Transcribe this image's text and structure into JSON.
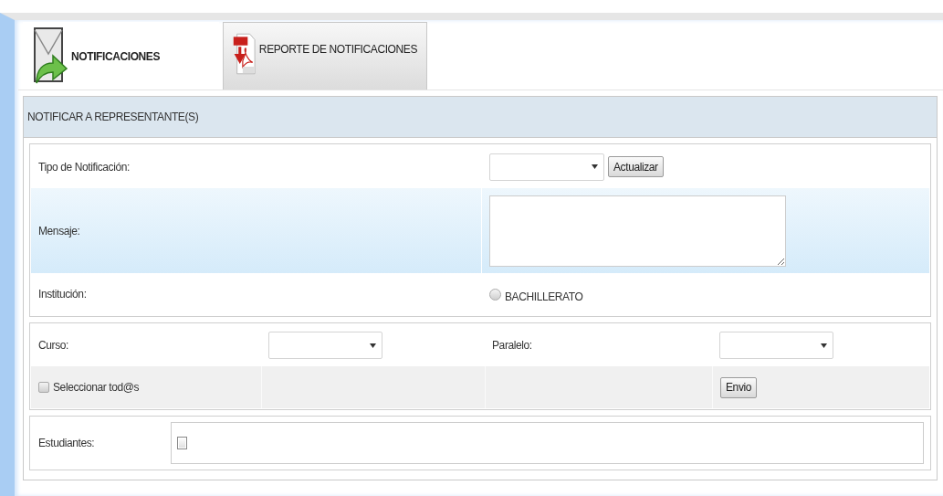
{
  "tabs": [
    {
      "label": "NOTIFICACIONES",
      "selected": true,
      "kind": "mail"
    },
    {
      "label": "REPORTE DE NOTIFICACIONES",
      "selected": false,
      "kind": "pdf"
    }
  ],
  "panel": {
    "title": "NOTIFICAR A REPRESENTANTE(S)"
  },
  "form": {
    "tipo": {
      "label": "Tipo de Notificación:",
      "button": "Actualizar"
    },
    "mensaje": {
      "label": "Mensaje:"
    },
    "institucion": {
      "label": "Institución:",
      "options": [
        {
          "label": "BACHILLERATO",
          "selected": false
        }
      ]
    }
  },
  "filters": {
    "curso": {
      "label": "Curso:"
    },
    "paralelo": {
      "label": "Paralelo:"
    },
    "select_all": {
      "label": "Seleccionar tod@s",
      "checked": false
    },
    "send_button": "Envio"
  },
  "students": {
    "label": "Estudiantes:",
    "items": [
      {
        "checked": false
      }
    ]
  }
}
